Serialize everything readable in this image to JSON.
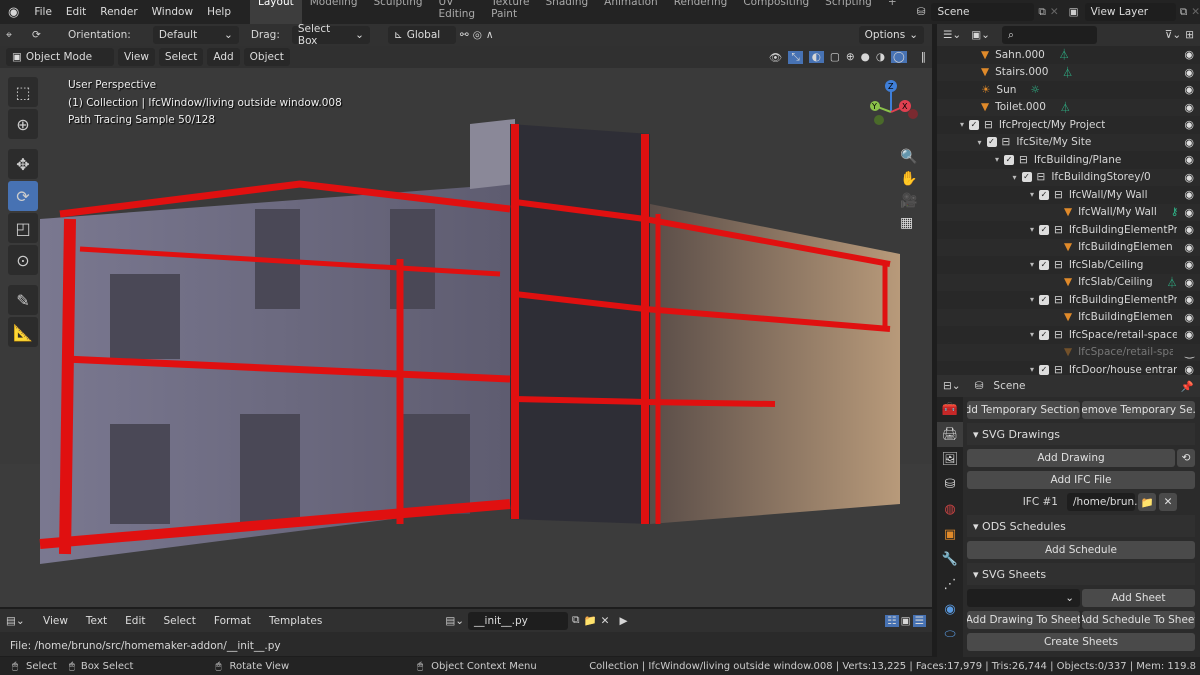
{
  "app": {
    "menus": [
      "File",
      "Edit",
      "Render",
      "Window",
      "Help"
    ],
    "workspaces": [
      "Layout",
      "Modeling",
      "Sculpting",
      "UV Editing",
      "Texture Paint",
      "Shading",
      "Animation",
      "Rendering",
      "Compositing",
      "Scripting"
    ],
    "active_workspace": "Layout",
    "add_workspace": "+",
    "scene": "Scene",
    "view_layer": "View Layer"
  },
  "tool_header": {
    "orientation_label": "Orientation:",
    "orientation": "Default",
    "drag_label": "Drag:",
    "drag": "Select Box",
    "transform": "Global",
    "options": "Options"
  },
  "view_header": {
    "mode": "Object Mode",
    "menus": [
      "View",
      "Select",
      "Add",
      "Object"
    ]
  },
  "viewport": {
    "line1": "User Perspective",
    "line2": "(1) Collection | IfcWindow/living outside window.008",
    "line3": "Path Tracing Sample 50/128",
    "section_color": "#e01010",
    "gizmo": {
      "x": "X",
      "y": "Y",
      "z": "Z"
    }
  },
  "toolbar": [
    "select-box",
    "cursor",
    "move",
    "rotate",
    "scale",
    "transform",
    "annotate",
    "measure"
  ],
  "outliner": {
    "items": [
      {
        "label": "Sahn.000",
        "depth": 0,
        "type": "mesh",
        "extra": "mesh-data"
      },
      {
        "label": "Stairs.000",
        "depth": 0,
        "type": "mesh",
        "extra": "mesh-data"
      },
      {
        "label": "Sun",
        "depth": 0,
        "type": "light",
        "extra": "sun"
      },
      {
        "label": "Toilet.000",
        "depth": 0,
        "type": "mesh",
        "extra": "mesh-data"
      },
      {
        "label": "IfcProject/My Project",
        "depth": 0,
        "type": "collection"
      },
      {
        "label": "IfcSite/My Site",
        "depth": 1,
        "type": "collection"
      },
      {
        "label": "IfcBuilding/Plane",
        "depth": 2,
        "type": "collection"
      },
      {
        "label": "IfcBuildingStorey/0",
        "depth": 3,
        "type": "collection"
      },
      {
        "label": "IfcWall/My Wall",
        "depth": 4,
        "type": "collection"
      },
      {
        "label": "IfcWall/My Wall",
        "depth": 4,
        "type": "mesh",
        "extra": "key"
      },
      {
        "label": "IfcBuildingElementProxy",
        "depth": 4,
        "type": "collection"
      },
      {
        "label": "IfcBuildingElementProxy",
        "depth": 4,
        "type": "mesh"
      },
      {
        "label": "IfcSlab/Ceiling",
        "depth": 4,
        "type": "collection"
      },
      {
        "label": "IfcSlab/Ceiling",
        "depth": 4,
        "type": "mesh",
        "extra": "mesh-data"
      },
      {
        "label": "IfcBuildingElementProxy",
        "depth": 4,
        "type": "collection"
      },
      {
        "label": "IfcBuildingElementProxy",
        "depth": 4,
        "type": "mesh"
      },
      {
        "label": "IfcSpace/retail-space",
        "depth": 4,
        "type": "collection"
      },
      {
        "label": "IfcSpace/retail-space",
        "depth": 4,
        "type": "mesh",
        "hidden": true
      },
      {
        "label": "IfcDoor/house entrance",
        "depth": 4,
        "type": "collection"
      }
    ]
  },
  "properties": {
    "context": "Scene",
    "add_temp_section": "Add Temporary Section...",
    "remove_temp_section": "Remove Temporary Se...",
    "svg_drawings": "SVG Drawings",
    "add_drawing": "Add Drawing",
    "add_ifc_file": "Add IFC File",
    "ifc_label": "IFC #1",
    "ifc_path": "/home/brun...",
    "ods_schedules": "ODS Schedules",
    "add_schedule": "Add Schedule",
    "svg_sheets": "SVG Sheets",
    "add_sheet": "Add Sheet",
    "add_drawing_to_sheet": "Add Drawing To Sheet",
    "add_schedule_to_sheet": "Add Schedule To Sheet",
    "create_sheets": "Create Sheets"
  },
  "text_editor": {
    "menus": [
      "View",
      "Text",
      "Edit",
      "Select",
      "Format",
      "Templates"
    ],
    "filename": "__init__.py",
    "filepath": "File: /home/bruno/src/homemaker-addon/__init__.py"
  },
  "status": {
    "select": "Select",
    "box_select": "Box Select",
    "rotate_view": "Rotate View",
    "context_menu": "Object Context Menu",
    "info": "Collection | IfcWindow/living outside window.008 | Verts:13,225 | Faces:17,979 | Tris:26,744 | Objects:0/337 | Mem: 119.8"
  }
}
